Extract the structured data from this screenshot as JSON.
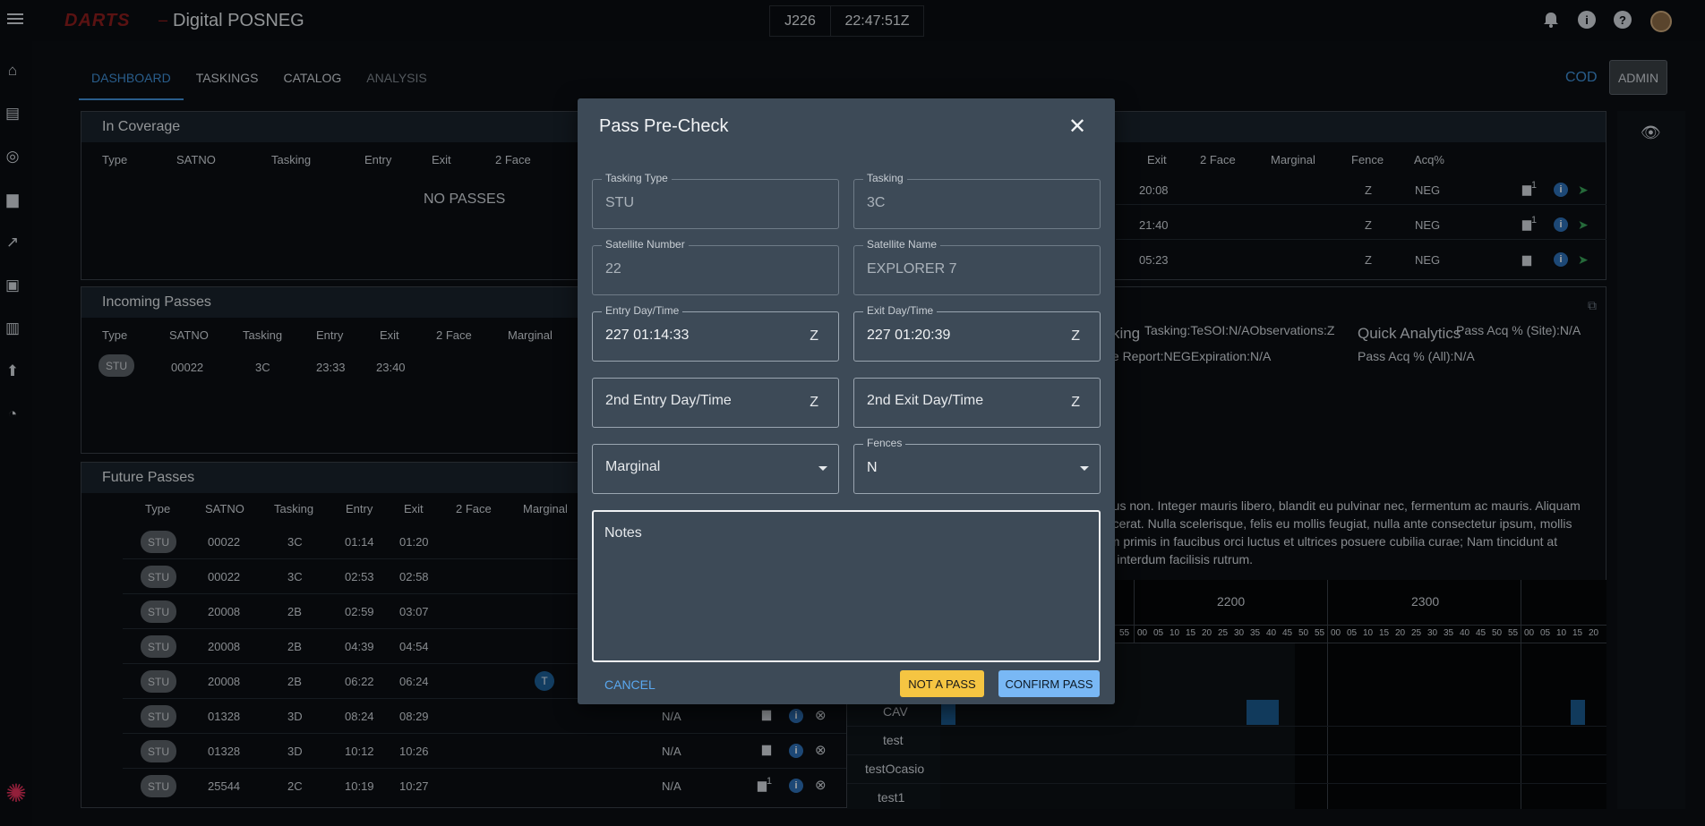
{
  "header": {
    "logo_text": "DARTS",
    "separator": "–",
    "title": "Digital POSNEG",
    "julian_day": "J226",
    "zulu_time": "22:47:51Z"
  },
  "nav": {
    "tabs": [
      "DASHBOARD",
      "TASKINGS",
      "CATALOG",
      "ANALYSIS"
    ],
    "cod_label": "COD",
    "admin_label": "ADMIN"
  },
  "in_coverage": {
    "title": "In Coverage",
    "columns": [
      "Type",
      "SATNO",
      "Tasking",
      "Entry",
      "Exit",
      "2 Face"
    ],
    "empty_text": "NO PASSES",
    "right_columns": [
      "Exit",
      "2 Face",
      "Marginal",
      "Fence",
      "Acq%"
    ],
    "right_rows": [
      {
        "exit": "20:08",
        "fence": "Z",
        "acq": "NEG",
        "badge": "1"
      },
      {
        "exit": "21:40",
        "fence": "Z",
        "acq": "NEG",
        "badge": "1"
      },
      {
        "exit": "05:23",
        "fence": "Z",
        "acq": "NEG",
        "badge": ""
      }
    ]
  },
  "incoming": {
    "title": "Incoming Passes",
    "columns": [
      "Type",
      "SATNO",
      "Tasking",
      "Entry",
      "Exit",
      "2 Face",
      "Marginal"
    ],
    "rows": [
      {
        "type": "STU",
        "satno": "00022",
        "tasking": "3C",
        "entry": "23:33",
        "exit": "23:40"
      }
    ]
  },
  "future": {
    "title": "Future Passes",
    "columns": [
      "Type",
      "SATNO",
      "Tasking",
      "Entry",
      "Exit",
      "2 Face",
      "Marginal"
    ],
    "rows": [
      {
        "type": "STU",
        "satno": "00022",
        "tasking": "3C",
        "entry": "01:14",
        "exit": "01:20",
        "marginal": "",
        "fence": "",
        "badge": ""
      },
      {
        "type": "STU",
        "satno": "00022",
        "tasking": "3C",
        "entry": "02:53",
        "exit": "02:58",
        "marginal": "",
        "fence": "",
        "badge": ""
      },
      {
        "type": "STU",
        "satno": "20008",
        "tasking": "2B",
        "entry": "02:59",
        "exit": "03:07",
        "marginal": "",
        "fence": "",
        "badge": ""
      },
      {
        "type": "STU",
        "satno": "20008",
        "tasking": "2B",
        "entry": "04:39",
        "exit": "04:54",
        "marginal": "",
        "fence": "",
        "badge": ""
      },
      {
        "type": "STU",
        "satno": "20008",
        "tasking": "2B",
        "entry": "06:22",
        "exit": "06:24",
        "marginal": "T",
        "fence": "",
        "badge": ""
      },
      {
        "type": "STU",
        "satno": "01328",
        "tasking": "3D",
        "entry": "08:24",
        "exit": "08:29",
        "marginal": "",
        "fence": "N/A",
        "badge": ""
      },
      {
        "type": "STU",
        "satno": "01328",
        "tasking": "3D",
        "entry": "10:12",
        "exit": "10:26",
        "marginal": "",
        "fence": "N/A",
        "badge": ""
      },
      {
        "type": "STU",
        "satno": "25544",
        "tasking": "2C",
        "entry": "10:19",
        "exit": "10:27",
        "marginal": "",
        "fence": "N/A",
        "badge": "1"
      }
    ]
  },
  "details": {
    "tasking_heading": "asking",
    "tasking_line1": "Tasking:TeSOI:N/AObservations:Z",
    "tasking_line2": "pice Report:NEGExpiration:N/A",
    "qa_heading": "Quick Analytics",
    "qa_line1": "Pass Acq % (Site):N/A",
    "qa_line2": "Pass Acq % (All):N/A",
    "lorem": [
      "uctus non. Integer mauris libero, blandit eu pulvinar nec, fermentum ac mauris. Aliquam",
      "placerat. Nulla scelerisque, felis eu mollis feugiat, nulla ante consectetur ipsum, mollis",
      "sum primis in faucibus orci luctus et ultrices posuere cubilia curae; Nam tincidunt at",
      "am interdum facilisis rutrum."
    ]
  },
  "timeline": {
    "hours": [
      "2200",
      "2300"
    ],
    "minutes": [
      "00",
      "05",
      "10",
      "15",
      "20",
      "25",
      "30",
      "35",
      "40",
      "45",
      "50",
      "55"
    ],
    "left_minutes": [
      "55"
    ],
    "tail_minutes": [
      "00",
      "05",
      "10",
      "15",
      "20"
    ],
    "rows": [
      "CAV",
      "test",
      "testOcasio",
      "test1"
    ]
  },
  "modal": {
    "title": "Pass Pre-Check",
    "tasking_type_label": "Tasking Type",
    "tasking_type_value": "STU",
    "tasking_label": "Tasking",
    "tasking_value": "3C",
    "sat_number_label": "Satellite Number",
    "sat_number_value": "22",
    "sat_name_label": "Satellite Name",
    "sat_name_value": "EXPLORER 7",
    "entry_label": "Entry Day/Time",
    "entry_value": "227 01:14:33",
    "exit_label": "Exit Day/Time",
    "exit_value": "227 01:20:39",
    "zone": "Z",
    "entry2_placeholder": "2nd Entry Day/Time",
    "exit2_placeholder": "2nd Exit Day/Time",
    "marginal_placeholder": "Marginal",
    "fences_label": "Fences",
    "fences_value": "N",
    "notes_placeholder": "Notes",
    "cancel_label": "CANCEL",
    "not_pass_label": "NOT A PASS",
    "confirm_label": "CONFIRM PASS"
  }
}
